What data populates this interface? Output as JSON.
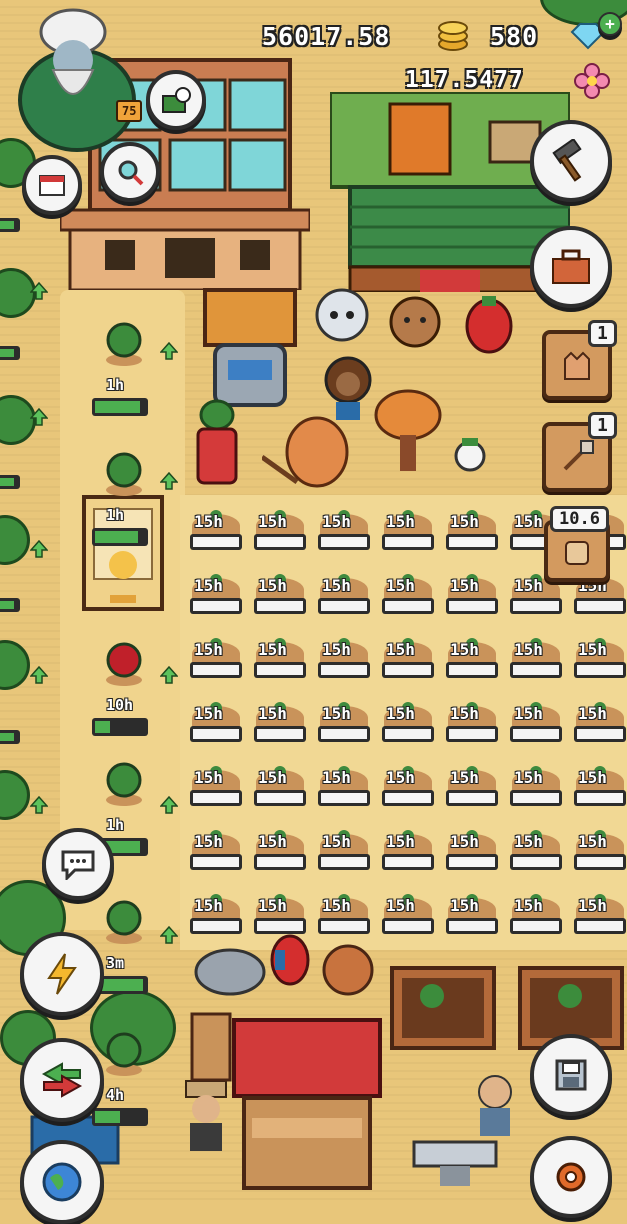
{
  "hud": {
    "coins": "56017.58",
    "gems": "580",
    "flowers": "117.5477",
    "level": "75"
  },
  "icons": {
    "coin": "coin-stack-icon",
    "gem": "diamond-gem-icon",
    "flower": "pink-flower-icon"
  },
  "right_buttons": {
    "build_label": "",
    "toolbox_label": "",
    "glove_count": "1",
    "sack_count": "1",
    "sign_value": "10.6"
  },
  "side_plots": [
    {
      "time": "1h",
      "progress": 0.9
    },
    {
      "time": "1h",
      "progress": 0.85
    },
    {
      "time": "10h",
      "progress": 0.3
    },
    {
      "time": "1h",
      "progress": 0.9
    },
    {
      "time": "3m",
      "progress": 0.95
    },
    {
      "time": "4h",
      "progress": 0.5
    }
  ],
  "farm": {
    "time": "15h",
    "rows": 7,
    "cols": 7
  },
  "colors": {
    "ground": "#e8c67a",
    "grass": "#3c8c3c",
    "bar_fill": "#4caf50"
  }
}
